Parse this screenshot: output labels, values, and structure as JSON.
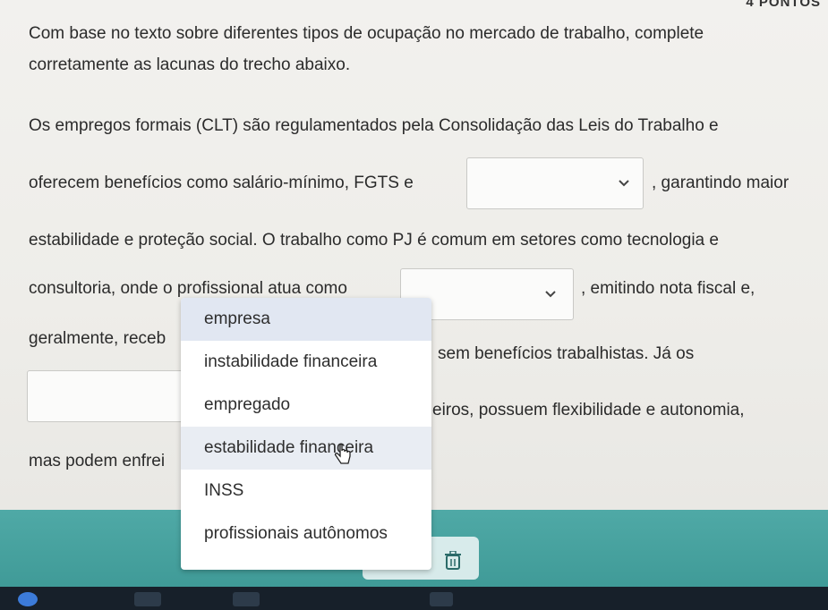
{
  "corner_label": "4 PONTOS",
  "prompt": {
    "line1": "Com base no texto sobre diferentes tipos de ocupação no mercado de trabalho, complete",
    "line2": "corretamente as lacunas do trecho abaixo."
  },
  "passage": {
    "l1": "Os empregos formais (CLT) são regulamentados pela Consolidação das Leis do Trabalho e",
    "l2a": "oferecem benefícios como salário-mínimo, FGTS e",
    "l2b": ", garantindo maior",
    "l3": "estabilidade e proteção social. O trabalho como PJ é comum em setores como tecnologia e",
    "l4a": "consultoria, onde o profissional atua como",
    "l4b": ", emitindo nota fiscal e,",
    "l5a": "geralmente, receb",
    "l5b": "sem benefícios trabalhistas. Já os",
    "l6b": "eiros, possuem flexibilidade e autonomia,",
    "l7a": "mas podem enfrei"
  },
  "dropdown_options": [
    "empresa",
    "instabilidade financeira",
    "empregado",
    "estabilidade financeira",
    "INSS",
    "profissionais autônomos"
  ],
  "icons": {
    "chevron": "chevron-down-icon",
    "cursor": "hand-cursor-icon",
    "trash": "trash-icon"
  },
  "colors": {
    "highlight": "#e1e7f2",
    "band": "#4fa9a6",
    "taskbar": "#17202a"
  }
}
